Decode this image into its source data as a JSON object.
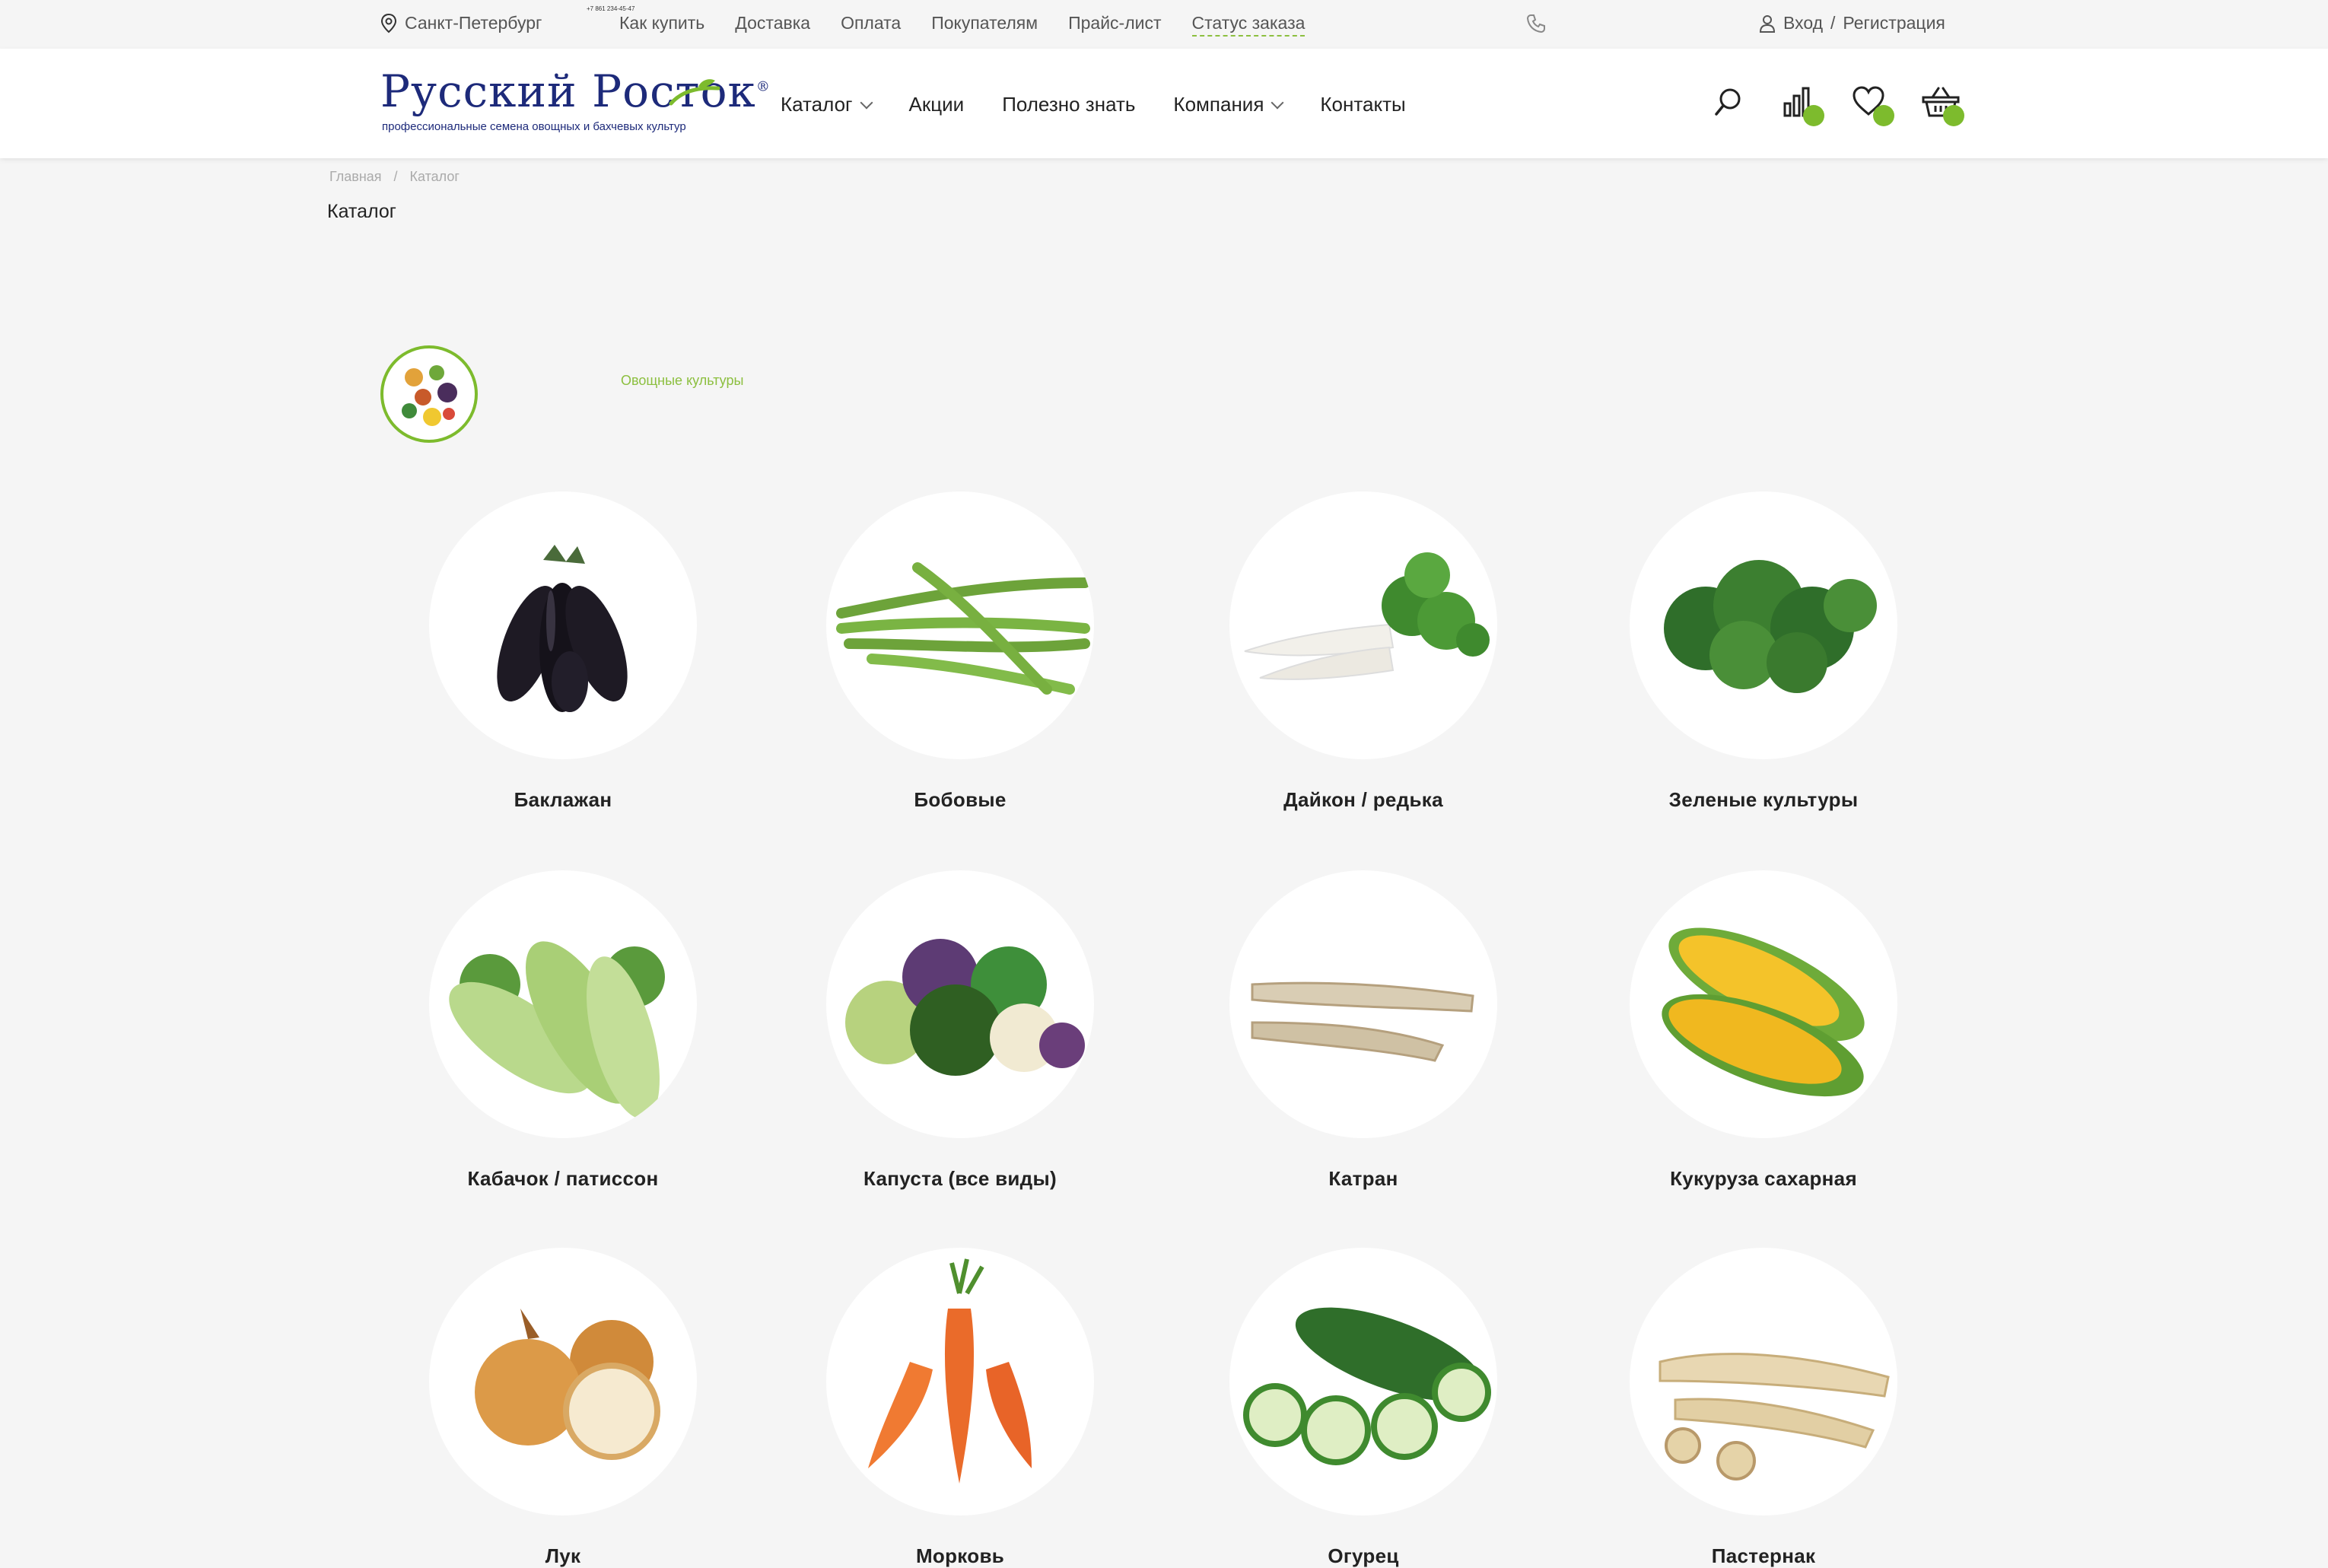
{
  "topbar": {
    "city": "Санкт-Петербург",
    "tiny_phone": "+7 861 234-45-47",
    "links": [
      "Как купить",
      "Доставка",
      "Оплата",
      "Покупателям",
      "Прайс-лист",
      "Статус заказа"
    ],
    "login": "Вход",
    "separator": "/",
    "register": "Регистрация"
  },
  "header": {
    "logo_title": "Русский Росток",
    "logo_reg": "®",
    "logo_subtitle": "профессиональные семена овощных и бахчевых культур",
    "nav": [
      "Каталог",
      "Акции",
      "Полезно знать",
      "Компания",
      "Контакты"
    ],
    "icons": [
      "search-icon",
      "compare-icon",
      "heart-icon",
      "basket-icon"
    ],
    "accent_color": "#7dbb2d"
  },
  "breadcrumb": {
    "home": "Главная",
    "separator": "/",
    "current": "Каталог"
  },
  "page_title": "Каталог",
  "section": {
    "title": "Овощные культуры"
  },
  "catalog": [
    {
      "label": "Баклажан",
      "icon": "eggplant-icon"
    },
    {
      "label": "Бобовые",
      "icon": "green-beans-icon"
    },
    {
      "label": "Дайкон / редька",
      "icon": "daikon-icon"
    },
    {
      "label": "Зеленые культуры",
      "icon": "greens-icon"
    },
    {
      "label": "Кабачок / патиссон",
      "icon": "zucchini-icon"
    },
    {
      "label": "Капуста (все виды)",
      "icon": "cabbage-icon"
    },
    {
      "label": "Катран",
      "icon": "katran-root-icon"
    },
    {
      "label": "Кукуруза сахарная",
      "icon": "corn-icon"
    },
    {
      "label": "Лук",
      "icon": "onion-icon"
    },
    {
      "label": "Морковь",
      "icon": "carrot-icon"
    },
    {
      "label": "Огурец",
      "icon": "cucumber-icon"
    },
    {
      "label": "Пастернак",
      "icon": "parsnip-icon"
    }
  ]
}
